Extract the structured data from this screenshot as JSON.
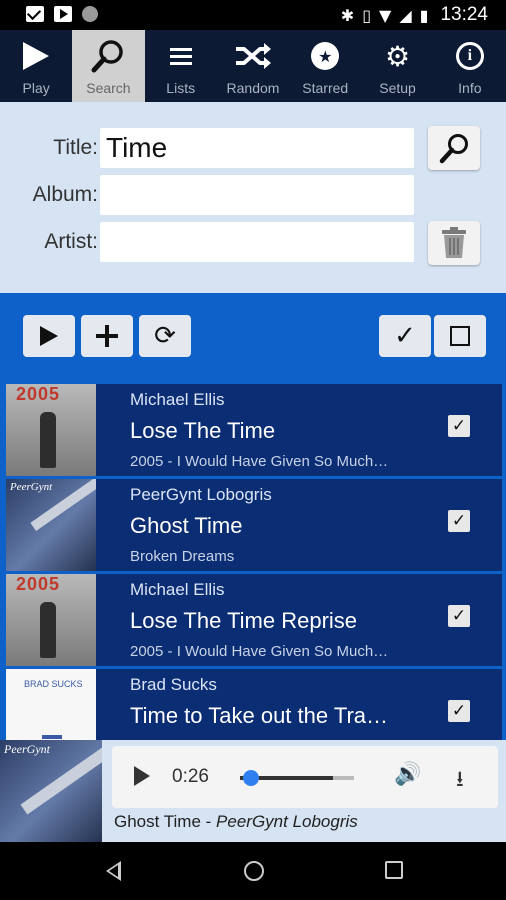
{
  "status_bar": {
    "time": "13:24"
  },
  "nav": [
    {
      "label": "Play",
      "icon": "play-icon"
    },
    {
      "label": "Search",
      "icon": "search-icon",
      "active": true
    },
    {
      "label": "Lists",
      "icon": "list-icon"
    },
    {
      "label": "Random",
      "icon": "shuffle-icon"
    },
    {
      "label": "Starred",
      "icon": "star-icon"
    },
    {
      "label": "Setup",
      "icon": "gear-icon"
    },
    {
      "label": "Info",
      "icon": "info-icon"
    }
  ],
  "search_form": {
    "title_label": "Title:",
    "title_value": "Time",
    "album_label": "Album:",
    "album_value": "",
    "artist_label": "Artist:",
    "artist_value": ""
  },
  "results": [
    {
      "artist": "Michael Ellis",
      "title": "Lose The Time",
      "album": "2005 - I Would Have Given So Much…",
      "checked": true,
      "art": "2005"
    },
    {
      "artist": "PeerGynt Lobogris",
      "title": "Ghost Time",
      "album": "Broken Dreams",
      "checked": true,
      "art": "peergynt"
    },
    {
      "artist": "Michael Ellis",
      "title": "Lose The Time Reprise",
      "album": "2005 - I Would Have Given So Much…",
      "checked": true,
      "art": "2005"
    },
    {
      "artist": "Brad Sucks",
      "title": "Time to Take out the Tra…",
      "album": "",
      "checked": true,
      "art": "bradsucks"
    }
  ],
  "player": {
    "elapsed": "0:26",
    "progress": 0.1,
    "buffered": 0.82,
    "track_title": "Ghost Time",
    "separator": " - ",
    "track_artist": "PeerGynt Lobogris"
  }
}
